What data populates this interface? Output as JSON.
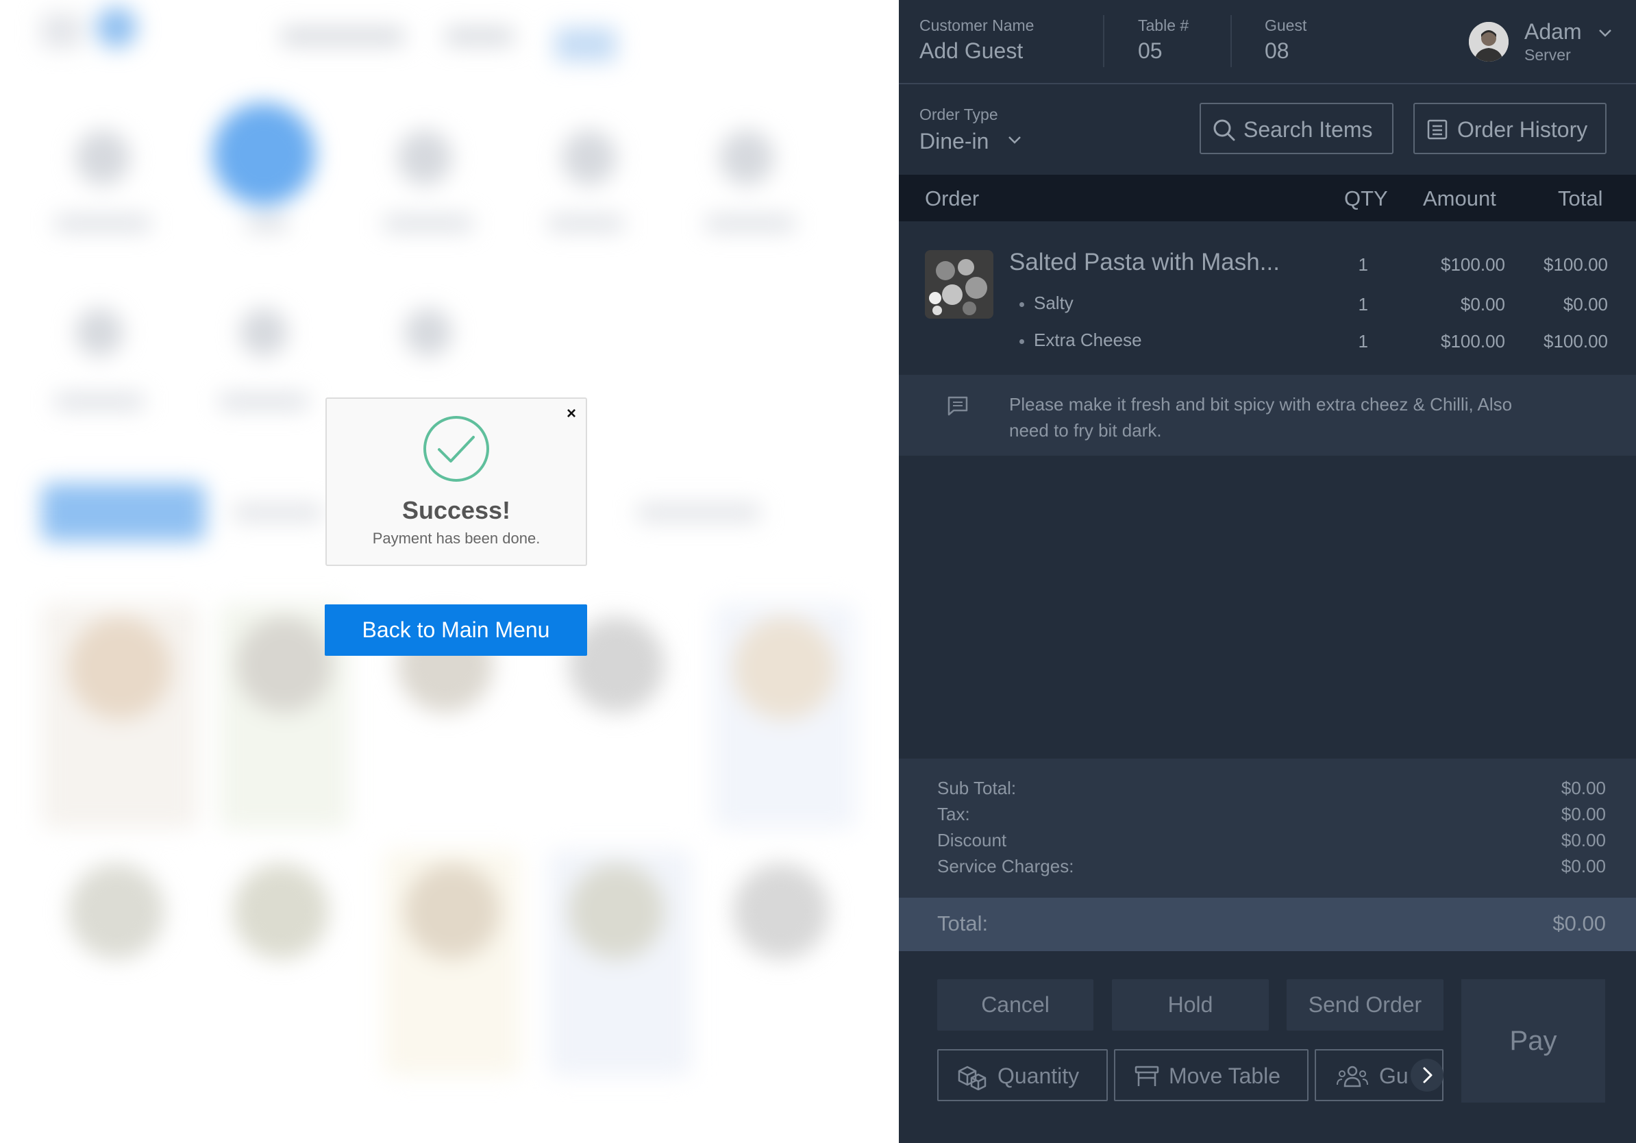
{
  "modal": {
    "title": "Success!",
    "message": "Payment has been done.",
    "close_symbol": "×",
    "check_icon": "check-circle-icon",
    "check_color": "#5fbf9c"
  },
  "back_button": {
    "label": "Back to Main Menu",
    "color": "#0a7ee6"
  },
  "header": {
    "customer_label": "Customer Name",
    "customer_value": "Add Guest",
    "table_label": "Table #",
    "table_value": "05",
    "guest_label": "Guest",
    "guest_value": "08",
    "server_name": "Adam",
    "server_role": "Server"
  },
  "order_type": {
    "label": "Order Type",
    "value": "Dine-in"
  },
  "toolbar": {
    "search_label": "Search Items",
    "history_label": "Order History"
  },
  "table_headers": {
    "order": "Order",
    "qty": "QTY",
    "amount": "Amount",
    "total": "Total"
  },
  "order_item": {
    "name": "Salted Pasta with Mash...",
    "qty": "1",
    "amount": "$100.00",
    "total": "$100.00",
    "modifiers": [
      {
        "name": "Salty",
        "qty": "1",
        "amount": "$0.00",
        "total": "$0.00"
      },
      {
        "name": "Extra Cheese",
        "qty": "1",
        "amount": "$100.00",
        "total": "$100.00"
      }
    ]
  },
  "note": {
    "icon": "comment-icon",
    "text": "Please make it fresh and bit spicy with extra cheez & Chilli, Also need to fry bit dark."
  },
  "totals": {
    "subtotal_label": "Sub Total:",
    "subtotal": "$0.00",
    "tax_label": "Tax:",
    "tax": "$0.00",
    "discount_label": "Discount",
    "discount": "$0.00",
    "service_label": "Service Charges:",
    "service": "$0.00",
    "total_label": "Total:",
    "total": "$0.00"
  },
  "actions": {
    "cancel": "Cancel",
    "hold": "Hold",
    "send_order": "Send Order",
    "pay": "Pay",
    "quantity": "Quantity",
    "move_table": "Move Table",
    "guest_truncated": "Gu"
  },
  "colors": {
    "panel_bg": "#232d3b",
    "table_header_bg": "#131a25",
    "accent_blue": "#0a7ee6"
  }
}
